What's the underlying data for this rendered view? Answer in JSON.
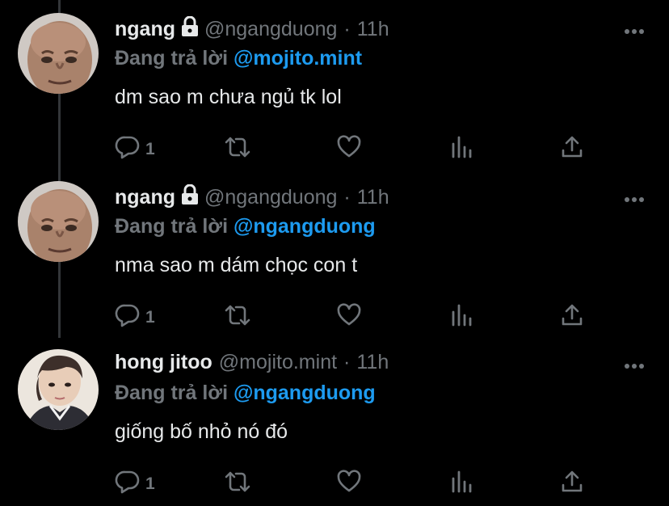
{
  "tweets": [
    {
      "name": "ngang",
      "locked": true,
      "handle": "@ngangduong",
      "dot": "·",
      "time": "11h",
      "replying_prefix": "Đang trả lời ",
      "replying_to": "@mojito.mint",
      "text": "dm sao m chưa ngủ tk lol",
      "reply_count": "1"
    },
    {
      "name": "ngang",
      "locked": true,
      "handle": "@ngangduong",
      "dot": "·",
      "time": "11h",
      "replying_prefix": "Đang trả lời ",
      "replying_to": "@ngangduong",
      "text": "nma sao m dám chọc con t",
      "reply_count": "1"
    },
    {
      "name": "hong jitoo",
      "locked": false,
      "handle": "@mojito.mint",
      "dot": "·",
      "time": "11h",
      "replying_prefix": "Đang trả lời ",
      "replying_to": "@ngangduong",
      "text": "giống bố nhỏ nó đó",
      "reply_count": "1"
    }
  ],
  "icons": [
    "reply-icon",
    "retweet-icon",
    "like-icon",
    "analytics-icon",
    "share-icon",
    "more-icon",
    "lock-icon"
  ],
  "colors": {
    "background": "#000000",
    "text": "#e7e9ea",
    "muted": "#71767b",
    "accent": "#1d9bf0",
    "thread_line": "#333639"
  }
}
